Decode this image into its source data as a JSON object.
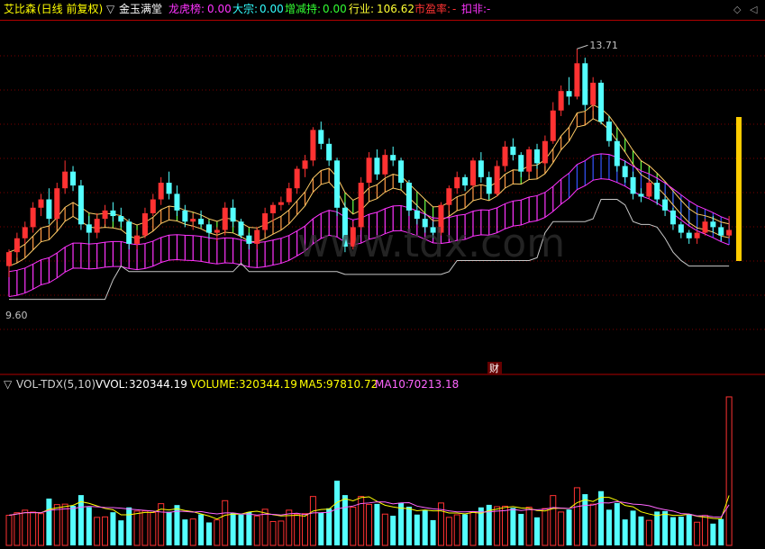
{
  "header": {
    "stock_name": "艾比森",
    "period": "(日线 前复权)",
    "module": "金玉满堂",
    "items": [
      {
        "label": "龙虎榜:",
        "value": "0.00",
        "color": "#ff33ff"
      },
      {
        "label": "大宗:",
        "value": "0.00",
        "color": "#33ffff"
      },
      {
        "label": "增减持:",
        "value": "0.00",
        "color": "#33ff33"
      },
      {
        "label": "行业:",
        "value": "106.62",
        "color": "#ffff33"
      },
      {
        "label": "市盈率:",
        "value": "-",
        "color": "#ff3333"
      },
      {
        "label": "扣非:",
        "value": "-",
        "color": "#ff33ff"
      }
    ]
  },
  "annotations": {
    "high_label": "13.71",
    "low_label": "9.60",
    "finance_tag": "财",
    "watermark": "www.tdx.com"
  },
  "volume_header": {
    "indicator": "VOL-TDX(5,10)",
    "vvol_label": "VVOL:",
    "vvol_value": "320344.19",
    "volume_label": "VOLUME:",
    "volume_value": "320344.19",
    "ma5_label": "MA5:",
    "ma5_value": "97810.72",
    "ma10_label": "MA10:",
    "ma10_value": "70213.18"
  },
  "colors": {
    "up": "#ff3232",
    "down": "#54ffff",
    "ma5": "#ffff00",
    "ma10": "#ff66ff",
    "grid": "#7a0000",
    "band_upper": "#ff9944",
    "band_lower": "#ff33ff",
    "highlight_bar": "#ffcc00"
  },
  "chart_data": {
    "type": "candlestick",
    "title": "艾比森 (日线 前复权)",
    "price_range": [
      9.0,
      14.2
    ],
    "high": 13.71,
    "low": 9.6,
    "candles": [
      [
        9.8,
        10.1,
        9.6,
        10.05
      ],
      [
        10.05,
        10.4,
        9.95,
        10.3
      ],
      [
        10.3,
        10.6,
        10.2,
        10.5
      ],
      [
        10.5,
        10.95,
        10.4,
        10.85
      ],
      [
        10.85,
        11.1,
        10.7,
        11.0
      ],
      [
        11.0,
        11.2,
        10.55,
        10.65
      ],
      [
        10.65,
        11.3,
        10.6,
        11.2
      ],
      [
        11.2,
        11.7,
        11.1,
        11.5
      ],
      [
        11.5,
        11.6,
        11.15,
        11.25
      ],
      [
        11.25,
        11.35,
        10.45,
        10.55
      ],
      [
        10.55,
        10.7,
        10.2,
        10.4
      ],
      [
        10.4,
        10.75,
        10.3,
        10.65
      ],
      [
        10.65,
        10.9,
        10.55,
        10.8
      ],
      [
        10.8,
        10.95,
        10.6,
        10.7
      ],
      [
        10.7,
        10.85,
        10.5,
        10.6
      ],
      [
        10.6,
        10.65,
        10.1,
        10.2
      ],
      [
        10.2,
        10.45,
        10.1,
        10.35
      ],
      [
        10.35,
        10.85,
        10.3,
        10.75
      ],
      [
        10.75,
        11.1,
        10.7,
        11.0
      ],
      [
        11.0,
        11.4,
        10.9,
        11.3
      ],
      [
        11.3,
        11.5,
        11.0,
        11.1
      ],
      [
        11.1,
        11.25,
        10.7,
        10.8
      ],
      [
        10.8,
        10.9,
        10.5,
        10.6
      ],
      [
        10.6,
        10.75,
        10.45,
        10.65
      ],
      [
        10.65,
        10.8,
        10.5,
        10.55
      ],
      [
        10.55,
        10.6,
        10.3,
        10.4
      ],
      [
        10.4,
        10.5,
        10.25,
        10.45
      ],
      [
        10.45,
        10.95,
        10.35,
        10.85
      ],
      [
        10.85,
        11.0,
        10.5,
        10.6
      ],
      [
        10.6,
        10.65,
        10.3,
        10.35
      ],
      [
        10.35,
        10.4,
        10.1,
        10.2
      ],
      [
        10.2,
        10.5,
        10.1,
        10.45
      ],
      [
        10.45,
        10.85,
        10.4,
        10.75
      ],
      [
        10.75,
        10.95,
        10.6,
        10.9
      ],
      [
        10.9,
        11.05,
        10.8,
        10.95
      ],
      [
        10.95,
        11.3,
        10.9,
        11.2
      ],
      [
        11.2,
        11.6,
        11.1,
        11.55
      ],
      [
        11.55,
        11.8,
        11.4,
        11.7
      ],
      [
        11.7,
        12.3,
        11.6,
        12.25
      ],
      [
        12.25,
        12.4,
        11.9,
        12.0
      ],
      [
        12.0,
        12.1,
        11.6,
        11.7
      ],
      [
        11.7,
        11.75,
        10.7,
        10.85
      ],
      [
        10.85,
        10.95,
        10.05,
        10.15
      ],
      [
        10.15,
        10.6,
        10.1,
        10.5
      ],
      [
        10.5,
        11.4,
        10.45,
        11.3
      ],
      [
        11.3,
        11.85,
        11.2,
        11.75
      ],
      [
        11.75,
        11.9,
        11.35,
        11.45
      ],
      [
        11.45,
        11.9,
        11.4,
        11.8
      ],
      [
        11.8,
        11.95,
        11.6,
        11.7
      ],
      [
        11.7,
        11.75,
        11.2,
        11.3
      ],
      [
        11.3,
        11.35,
        10.7,
        10.8
      ],
      [
        10.8,
        10.9,
        10.55,
        10.65
      ],
      [
        10.65,
        10.75,
        10.4,
        10.5
      ],
      [
        10.5,
        10.6,
        10.3,
        10.4
      ],
      [
        10.4,
        10.95,
        10.35,
        10.9
      ],
      [
        10.9,
        11.25,
        10.8,
        11.2
      ],
      [
        11.2,
        11.5,
        11.1,
        11.4
      ],
      [
        11.4,
        11.45,
        11.15,
        11.25
      ],
      [
        11.25,
        11.75,
        11.2,
        11.7
      ],
      [
        11.7,
        11.85,
        11.3,
        11.4
      ],
      [
        11.4,
        11.5,
        11.0,
        11.1
      ],
      [
        11.1,
        11.7,
        11.05,
        11.6
      ],
      [
        11.6,
        12.05,
        11.5,
        11.95
      ],
      [
        11.95,
        12.1,
        11.7,
        11.8
      ],
      [
        11.8,
        11.85,
        11.4,
        11.5
      ],
      [
        11.5,
        11.95,
        11.45,
        11.9
      ],
      [
        11.9,
        12.0,
        11.55,
        11.65
      ],
      [
        11.65,
        12.15,
        11.6,
        12.05
      ],
      [
        12.05,
        12.75,
        12.0,
        12.6
      ],
      [
        12.6,
        13.05,
        12.5,
        12.95
      ],
      [
        12.95,
        13.2,
        12.7,
        12.85
      ],
      [
        12.85,
        13.71,
        12.8,
        13.45
      ],
      [
        13.45,
        13.55,
        12.6,
        12.7
      ],
      [
        12.7,
        13.2,
        12.6,
        13.1
      ],
      [
        13.1,
        13.15,
        12.35,
        12.4
      ],
      [
        12.4,
        12.5,
        11.95,
        12.05
      ],
      [
        12.05,
        12.1,
        11.5,
        11.6
      ],
      [
        11.6,
        11.7,
        11.3,
        11.4
      ],
      [
        11.4,
        11.5,
        11.0,
        11.1
      ],
      [
        11.1,
        11.2,
        10.95,
        11.05
      ],
      [
        11.05,
        11.35,
        11.0,
        11.3
      ],
      [
        11.3,
        11.35,
        10.9,
        11.0
      ],
      [
        11.0,
        11.05,
        10.7,
        10.8
      ],
      [
        10.8,
        10.85,
        10.45,
        10.55
      ],
      [
        10.55,
        10.6,
        10.3,
        10.4
      ],
      [
        10.4,
        10.45,
        10.2,
        10.3
      ],
      [
        10.3,
        10.45,
        10.2,
        10.4
      ],
      [
        10.4,
        10.65,
        10.35,
        10.6
      ],
      [
        10.6,
        10.7,
        10.4,
        10.5
      ],
      [
        10.5,
        10.55,
        10.25,
        10.35
      ],
      [
        10.35,
        10.7,
        10.3,
        10.45
      ]
    ],
    "volume_ma": {
      "MA5": 97810.72,
      "MA10": 70213.18,
      "VOLUME": 320344.19,
      "VVOL": 320344.19
    }
  }
}
